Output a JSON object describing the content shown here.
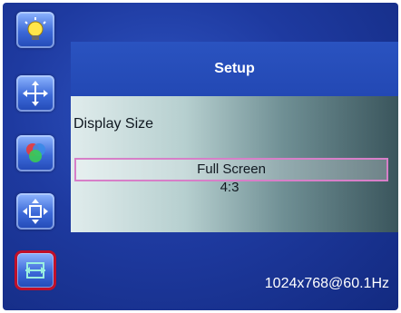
{
  "menu": {
    "icons": [
      {
        "name": "brightness-icon",
        "active": false
      },
      {
        "name": "position-icon",
        "active": false
      },
      {
        "name": "color-icon",
        "active": false
      },
      {
        "name": "image-size-icon",
        "active": false
      },
      {
        "name": "setup-icon",
        "active": true
      }
    ]
  },
  "header": {
    "title": "Setup"
  },
  "setting": {
    "label": "Display Size",
    "options": [
      {
        "label": "Full Screen",
        "selected": true
      },
      {
        "label": "4:3",
        "selected": false
      }
    ]
  },
  "status": {
    "resolution": "1024x768@60.1Hz"
  },
  "colors": {
    "background": "#1e3aa0",
    "title_bar": "#2348b4",
    "selection_border": "#d77fc8",
    "active_icon_border": "#c0102a"
  }
}
